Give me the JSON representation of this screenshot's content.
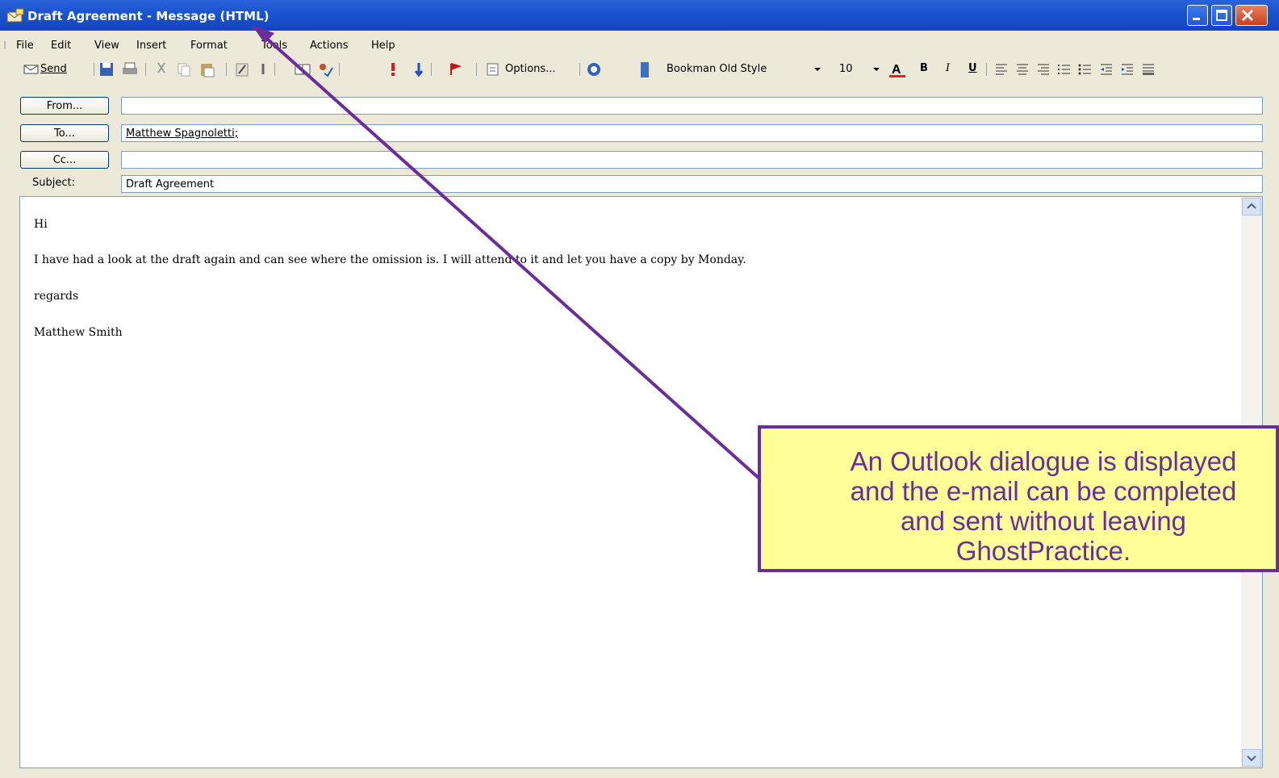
{
  "window": {
    "title": "Draft Agreement - Message (HTML)"
  },
  "menu": [
    "File",
    "Edit",
    "View",
    "Insert",
    "Format",
    "Tools",
    "Actions",
    "Help"
  ],
  "toolbar": {
    "send_label": "Send",
    "options_label": "Options...",
    "font_name": "Bookman Old Style",
    "font_size": "10",
    "bold": "B",
    "italic": "I",
    "underline": "U"
  },
  "header": {
    "from_label": "From...",
    "from_value": "",
    "to_label": "To...",
    "to_value": "Matthew Spagnoletti;",
    "cc_label": "Cc...",
    "cc_value": "",
    "subject_label": "Subject:",
    "subject_value": "Draft Agreement"
  },
  "body": {
    "lines": [
      "Hi",
      "I have had a look at the draft again and can see where the omission is. I will attend to it and let you have a copy by Monday.",
      "regards",
      "Matthew Smith"
    ]
  },
  "callout": {
    "lines": [
      "An Outlook dialogue is displayed",
      "and the e-mail can be completed",
      "and sent without leaving",
      "GhostPractice."
    ],
    "fill_color": "#ffff99",
    "border_color": "#6b2d9c"
  },
  "colors": {
    "titlebar": "#1a54d0",
    "arrow": "#6b2d9c"
  }
}
